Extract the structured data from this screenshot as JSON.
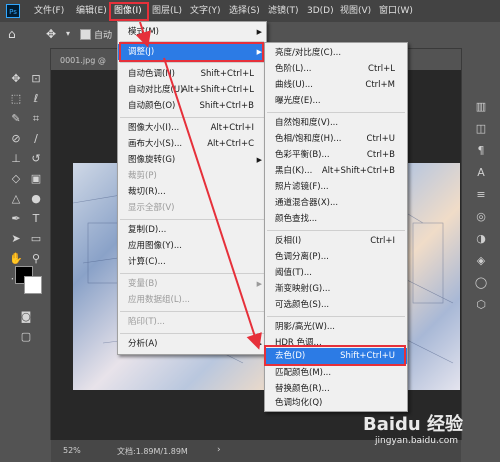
{
  "app_logo": "Ps",
  "menubar": {
    "items": [
      "文件(F)",
      "编辑(E)",
      "图像(I)",
      "图层(L)",
      "文字(Y)",
      "选择(S)",
      "滤镜(T)",
      "3D(D)",
      "视图(V)",
      "窗口(W)"
    ]
  },
  "options_bar": {
    "auto_select_label": "自动"
  },
  "doc_tab": {
    "title": "0001.jpg @"
  },
  "status_bar": {
    "zoom": "52%",
    "doc_info": "文档:1.89M/1.89M"
  },
  "image_menu": {
    "items": [
      {
        "label": "模式(M)",
        "shortcut": "",
        "submenu": true
      },
      {
        "label": "调整(J)",
        "shortcut": "",
        "submenu": true,
        "highlight": true
      },
      {
        "label": "自动色调(N)",
        "shortcut": "Shift+Ctrl+L"
      },
      {
        "label": "自动对比度(U)",
        "shortcut": "Alt+Shift+Ctrl+L"
      },
      {
        "label": "自动颜色(O)",
        "shortcut": "Shift+Ctrl+B"
      },
      {
        "label": "图像大小(I)...",
        "shortcut": "Alt+Ctrl+I"
      },
      {
        "label": "画布大小(S)...",
        "shortcut": "Alt+Ctrl+C"
      },
      {
        "label": "图像旋转(G)",
        "shortcut": "",
        "submenu": true
      },
      {
        "label": "裁剪(P)",
        "shortcut": "",
        "disabled": true
      },
      {
        "label": "裁切(R)...",
        "shortcut": ""
      },
      {
        "label": "显示全部(V)",
        "shortcut": "",
        "disabled": true
      },
      {
        "label": "复制(D)...",
        "shortcut": ""
      },
      {
        "label": "应用图像(Y)...",
        "shortcut": ""
      },
      {
        "label": "计算(C)...",
        "shortcut": ""
      },
      {
        "label": "变量(B)",
        "shortcut": "",
        "disabled": true,
        "submenu": true
      },
      {
        "label": "应用数据组(L)...",
        "shortcut": "",
        "disabled": true
      },
      {
        "label": "陷印(T)...",
        "shortcut": "",
        "disabled": true
      },
      {
        "label": "分析(A)",
        "shortcut": "",
        "submenu": true
      }
    ]
  },
  "adjust_menu": {
    "items": [
      {
        "label": "亮度/对比度(C)...",
        "shortcut": ""
      },
      {
        "label": "色阶(L)...",
        "shortcut": "Ctrl+L"
      },
      {
        "label": "曲线(U)...",
        "shortcut": "Ctrl+M"
      },
      {
        "label": "曝光度(E)...",
        "shortcut": ""
      },
      {
        "label": "自然饱和度(V)...",
        "shortcut": ""
      },
      {
        "label": "色相/饱和度(H)...",
        "shortcut": "Ctrl+U"
      },
      {
        "label": "色彩平衡(B)...",
        "shortcut": "Ctrl+B"
      },
      {
        "label": "黑白(K)...",
        "shortcut": "Alt+Shift+Ctrl+B"
      },
      {
        "label": "照片滤镜(F)...",
        "shortcut": ""
      },
      {
        "label": "通道混合器(X)...",
        "shortcut": ""
      },
      {
        "label": "颜色查找...",
        "shortcut": ""
      },
      {
        "label": "反相(I)",
        "shortcut": "Ctrl+I"
      },
      {
        "label": "色调分离(P)...",
        "shortcut": ""
      },
      {
        "label": "阈值(T)...",
        "shortcut": ""
      },
      {
        "label": "渐变映射(G)...",
        "shortcut": ""
      },
      {
        "label": "可选颜色(S)...",
        "shortcut": ""
      },
      {
        "label": "阴影/高光(W)...",
        "shortcut": ""
      },
      {
        "label": "HDR 色调...",
        "shortcut": ""
      },
      {
        "label": "去色(D)",
        "shortcut": "Shift+Ctrl+U",
        "highlight": true
      },
      {
        "label": "匹配颜色(M)...",
        "shortcut": ""
      },
      {
        "label": "替换颜色(R)...",
        "shortcut": ""
      },
      {
        "label": "色调均化(Q)",
        "shortcut": ""
      }
    ]
  },
  "watermark": {
    "brand": "Baidu 经验",
    "url": "jingyan.baidu.com"
  },
  "colors": {
    "highlight": "#2c7be5",
    "annotation_red": "#e6303a"
  }
}
